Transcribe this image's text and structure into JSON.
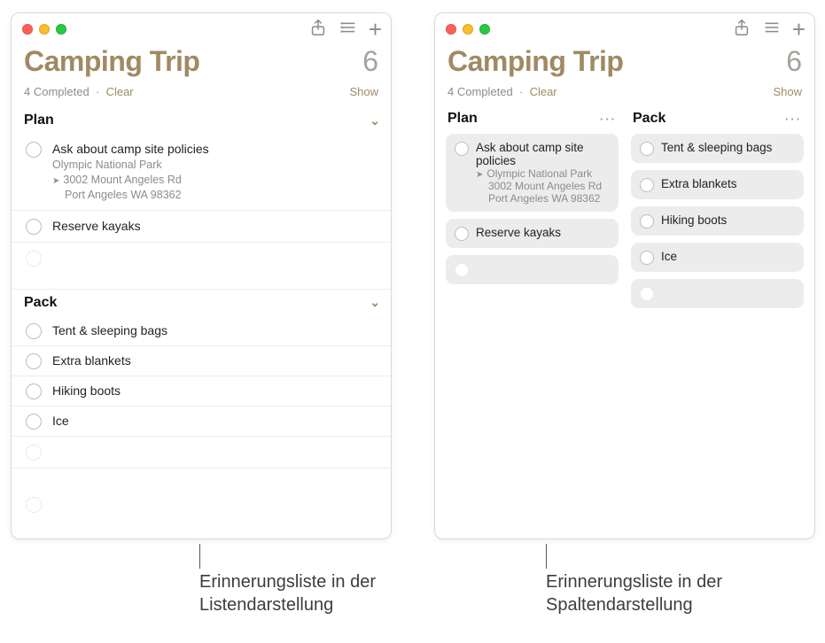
{
  "windows": {
    "listView": {
      "title": "Camping Trip",
      "count": "6",
      "completed": "4 Completed",
      "dot": "·",
      "clear": "Clear",
      "show": "Show",
      "sections": {
        "plan": {
          "header": "Plan",
          "items": [
            {
              "title": "Ask about camp site policies",
              "locationName": "Olympic National Park",
              "address1": "3002 Mount Angeles Rd",
              "address2": "Port Angeles WA 98362"
            },
            {
              "title": "Reserve kayaks"
            }
          ]
        },
        "pack": {
          "header": "Pack",
          "items": [
            {
              "title": "Tent & sleeping bags"
            },
            {
              "title": "Extra blankets"
            },
            {
              "title": "Hiking boots"
            },
            {
              "title": "Ice"
            }
          ]
        }
      }
    },
    "columnView": {
      "title": "Camping Trip",
      "count": "6",
      "completed": "4 Completed",
      "dot": "·",
      "clear": "Clear",
      "show": "Show",
      "columns": {
        "plan": {
          "header": "Plan",
          "more": "···",
          "cards": [
            {
              "title": "Ask about camp site policies",
              "locationName": "Olympic National Park",
              "address1": "3002 Mount Angeles Rd",
              "address2": "Port Angeles WA 98362"
            },
            {
              "title": "Reserve kayaks"
            }
          ]
        },
        "pack": {
          "header": "Pack",
          "more": "···",
          "cards": [
            {
              "title": "Tent & sleeping bags"
            },
            {
              "title": "Extra blankets"
            },
            {
              "title": "Hiking boots"
            },
            {
              "title": "Ice"
            }
          ]
        }
      }
    }
  },
  "callouts": {
    "left": "Erinnerungsliste in der Listendarstellung",
    "right": "Erinnerungsliste in der Spaltendarstellung"
  }
}
